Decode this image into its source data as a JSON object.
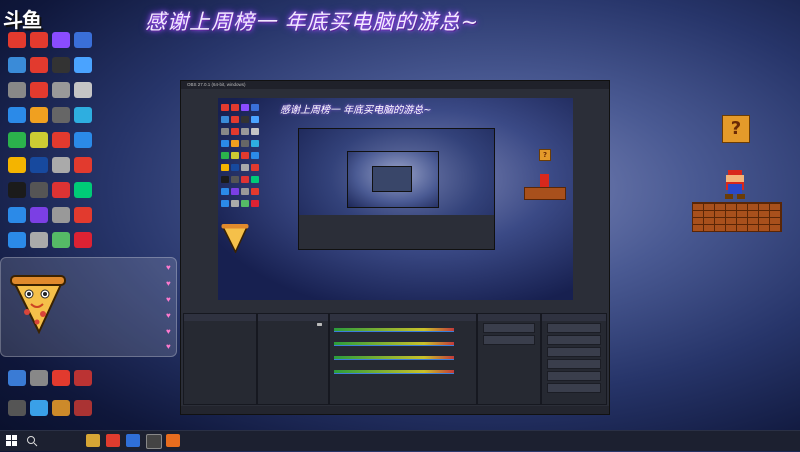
{
  "banner": "感谢上周榜一 年底买电脑的游总~",
  "logo": "斗鱼",
  "desktop_icons": [
    {
      "label": "",
      "color": "#e23a2e"
    },
    {
      "label": "",
      "color": "#e23a2e"
    },
    {
      "label": "",
      "color": "#8a4cff"
    },
    {
      "label": "",
      "color": "#3a6fd8"
    },
    {
      "label": "",
      "color": "#3a8bd8"
    },
    {
      "label": "",
      "color": "#e23a2e"
    },
    {
      "label": "",
      "color": "#333"
    },
    {
      "label": "",
      "color": "#4aa3ff"
    },
    {
      "label": "",
      "color": "#888"
    },
    {
      "label": "",
      "color": "#e23a2e"
    },
    {
      "label": "",
      "color": "#999"
    },
    {
      "label": "",
      "color": "#c5c5c5"
    },
    {
      "label": "",
      "color": "#2b8ae8"
    },
    {
      "label": "",
      "color": "#f0a020"
    },
    {
      "label": "",
      "color": "#666"
    },
    {
      "label": "",
      "color": "#2eaee0"
    },
    {
      "label": "",
      "color": "#2bb24c"
    },
    {
      "label": "",
      "color": "#cc3"
    },
    {
      "label": "",
      "color": "#e23a2e"
    },
    {
      "label": "",
      "color": "#2b8ae8"
    },
    {
      "label": "",
      "color": "#f4b400"
    },
    {
      "label": "",
      "color": "#17499e"
    },
    {
      "label": "",
      "color": "#aaa"
    },
    {
      "label": "",
      "color": "#e23a2e"
    },
    {
      "label": "",
      "color": "#1b1b1b"
    },
    {
      "label": "",
      "color": "#555"
    },
    {
      "label": "",
      "color": "#d33"
    },
    {
      "label": "",
      "color": "#0c7"
    },
    {
      "label": "",
      "color": "#2b8ae8"
    },
    {
      "label": "",
      "color": "#7b3fe4"
    },
    {
      "label": "",
      "color": "#999"
    },
    {
      "label": "",
      "color": "#e23a2e"
    },
    {
      "label": "",
      "color": "#2b8ae8"
    },
    {
      "label": "",
      "color": "#aaa"
    },
    {
      "label": "",
      "color": "#5b6"
    },
    {
      "label": "",
      "color": "#d23"
    }
  ],
  "bottom_icons": [
    {
      "label": "",
      "color": "#3a7bd5"
    },
    {
      "label": "",
      "color": "#888"
    },
    {
      "label": "",
      "color": "#e23a2e"
    },
    {
      "label": "",
      "color": "#b33"
    },
    {
      "label": "",
      "color": "#555"
    },
    {
      "label": "",
      "color": "#3aa0e8"
    },
    {
      "label": "",
      "color": "#cc8a2a"
    },
    {
      "label": "",
      "color": "#a33"
    }
  ],
  "chat": {
    "lines": [
      "",
      "",
      "",
      "",
      "",
      ""
    ]
  },
  "obs": {
    "window_title": "OBS 27.0.1 (64-bit, windows)",
    "menu": [
      "",
      "",
      "",
      "",
      "",
      ""
    ],
    "preview_title": "感谢上周榜一 年底买电脑的游总~",
    "docks": {
      "scenes": "",
      "sources": "",
      "mixer": "",
      "transitions": "",
      "controls": ""
    },
    "sources": [
      "",
      "",
      "",
      "",
      "",
      "",
      "",
      ""
    ],
    "meters": [
      "",
      "",
      "",
      ""
    ],
    "transition_fields": [
      "",
      ""
    ],
    "controls": [
      "",
      "",
      "",
      "",
      "",
      ""
    ],
    "status": ""
  },
  "taskbar": {
    "tray_text": "",
    "time": "",
    "date": ""
  },
  "colors": {
    "banner_glow": "#b36cff",
    "chat_text": "#ffe16a",
    "obs_bg": "#2b2e38",
    "taskbar": "#1c2030"
  }
}
